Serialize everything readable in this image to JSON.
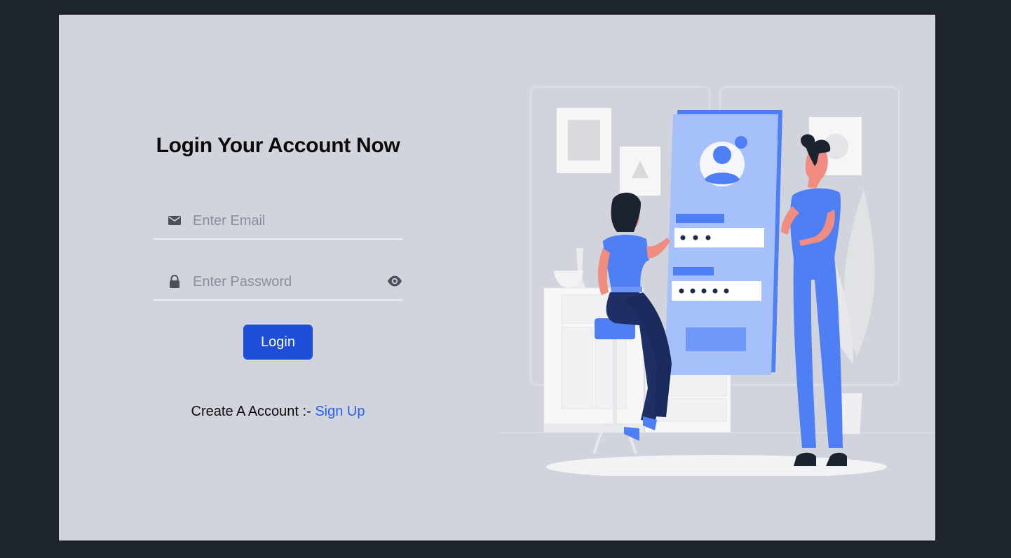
{
  "login": {
    "title": "Login Your Account Now",
    "email_placeholder": "Enter Email",
    "password_placeholder": "Enter Password",
    "login_button": "Login",
    "signup_prompt": "Create A Account :- ",
    "signup_link": "Sign Up"
  },
  "icons": {
    "email": "envelope-icon",
    "password": "lock-icon",
    "toggle_visibility": "eye-icon"
  },
  "colors": {
    "page_background": "#1e242c",
    "card_background": "#d1d4dc",
    "primary": "#1d4ed8",
    "link": "#2563eb",
    "illustration_accent": "#4f7ff5"
  }
}
